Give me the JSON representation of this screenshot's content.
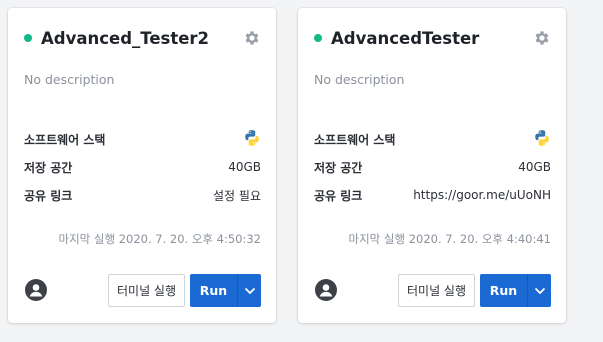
{
  "projects": [
    {
      "name": "Advanced_Tester2",
      "status_color": "#12b886",
      "description": "No description",
      "software_label": "소프트웨어 스택",
      "software_icon": "python-icon",
      "storage_label": "저장 공간",
      "storage_value": "40GB",
      "share_label": "공유 링크",
      "share_value": "설정 필요",
      "last_run": "마지막 실행 2020. 7. 20. 오후 4:50:32",
      "terminal_label": "터미널 실행",
      "run_label": "Run"
    },
    {
      "name": "AdvancedTester",
      "status_color": "#12b886",
      "description": "No description",
      "software_label": "소프트웨어 스택",
      "software_icon": "python-icon",
      "storage_label": "저장 공간",
      "storage_value": "40GB",
      "share_label": "공유 링크",
      "share_value": "https://goor.me/uUoNH",
      "last_run": "마지막 실행 2020. 7. 20. 오후 4:40:41",
      "terminal_label": "터미널 실행",
      "run_label": "Run"
    }
  ],
  "colors": {
    "accent": "#1b6ad4",
    "status_running": "#12b886"
  }
}
